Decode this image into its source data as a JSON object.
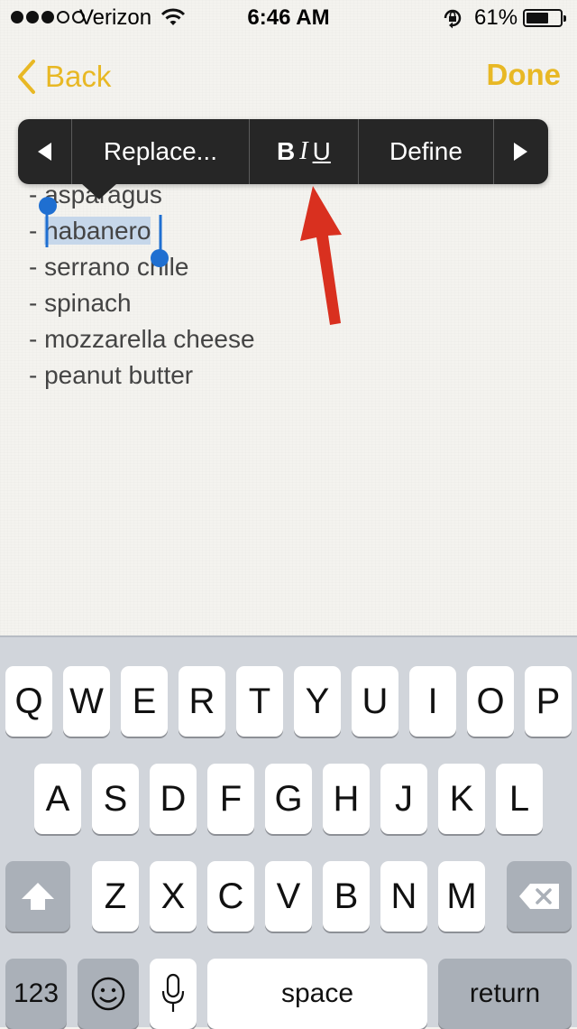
{
  "status_bar": {
    "carrier": "Verizon",
    "time": "6:46 AM",
    "battery_percent": "61%",
    "signal_bars": 3,
    "signal_total": 5
  },
  "nav": {
    "back_label": "Back",
    "done_label": "Done"
  },
  "edit_menu": {
    "replace_label": "Replace...",
    "bold_label": "B",
    "italic_label": "I",
    "underline_label": "U",
    "define_label": "Define"
  },
  "note": {
    "lines": [
      "- asparagus",
      "- ",
      "- serrano chile",
      "- spinach",
      "- mozzarella cheese",
      "- peanut butter"
    ],
    "selected_text": "habanero"
  },
  "keyboard": {
    "row1": [
      "Q",
      "W",
      "E",
      "R",
      "T",
      "Y",
      "U",
      "I",
      "O",
      "P"
    ],
    "row2": [
      "A",
      "S",
      "D",
      "F",
      "G",
      "H",
      "J",
      "K",
      "L"
    ],
    "row3": [
      "Z",
      "X",
      "C",
      "V",
      "B",
      "N",
      "M"
    ],
    "numbers_label": "123",
    "space_label": "space",
    "return_label": "return"
  },
  "colors": {
    "accent": "#e8b824",
    "menu_bg": "#262626",
    "selection": "#c6d7ea",
    "arrow": "#d9301f"
  },
  "icons": [
    "wifi-icon",
    "lock-rotation-icon",
    "battery-icon",
    "back-chevron-icon",
    "left-triangle-icon",
    "right-triangle-icon",
    "shift-icon",
    "delete-icon",
    "emoji-icon",
    "microphone-icon"
  ]
}
